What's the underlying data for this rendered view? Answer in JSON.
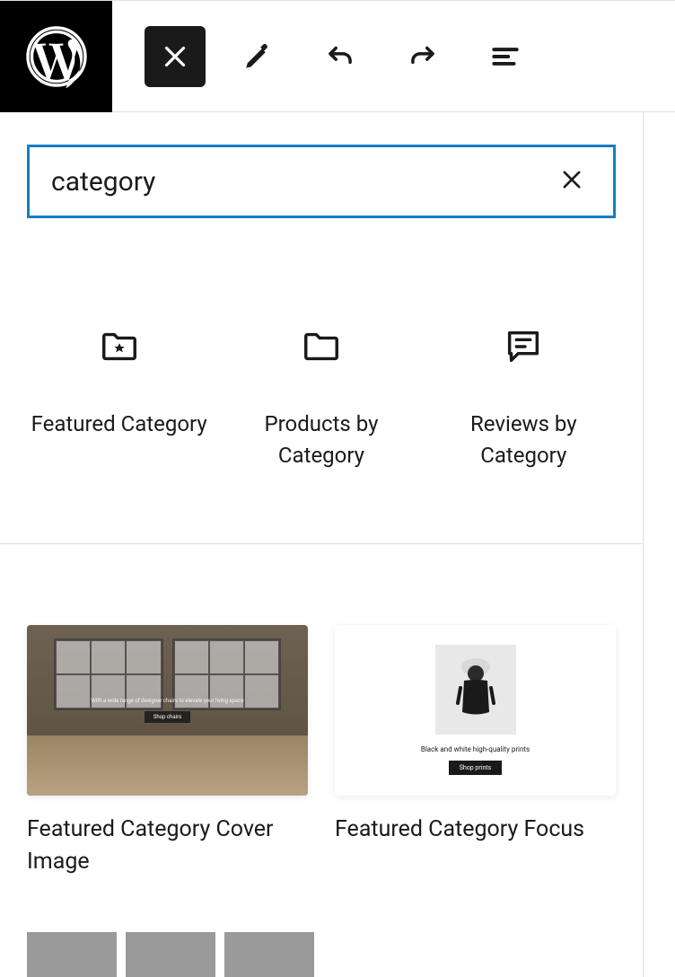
{
  "search": {
    "value": "category",
    "placeholder": ""
  },
  "blocks": [
    {
      "label": "Featured Category",
      "icon": "folder-star-icon"
    },
    {
      "label": "Products by Category",
      "icon": "folder-icon"
    },
    {
      "label": "Reviews by Category",
      "icon": "review-icon"
    }
  ],
  "patterns": [
    {
      "label": "Featured Category Cover Image",
      "preview": {
        "title": "",
        "subtitle": "With a wide range of designer chairs to elevate your living space",
        "button": "Shop chairs"
      }
    },
    {
      "label": "Featured Category Focus",
      "preview": {
        "caption": "Black and white high-quality prints",
        "button": "Shop prints"
      }
    }
  ]
}
